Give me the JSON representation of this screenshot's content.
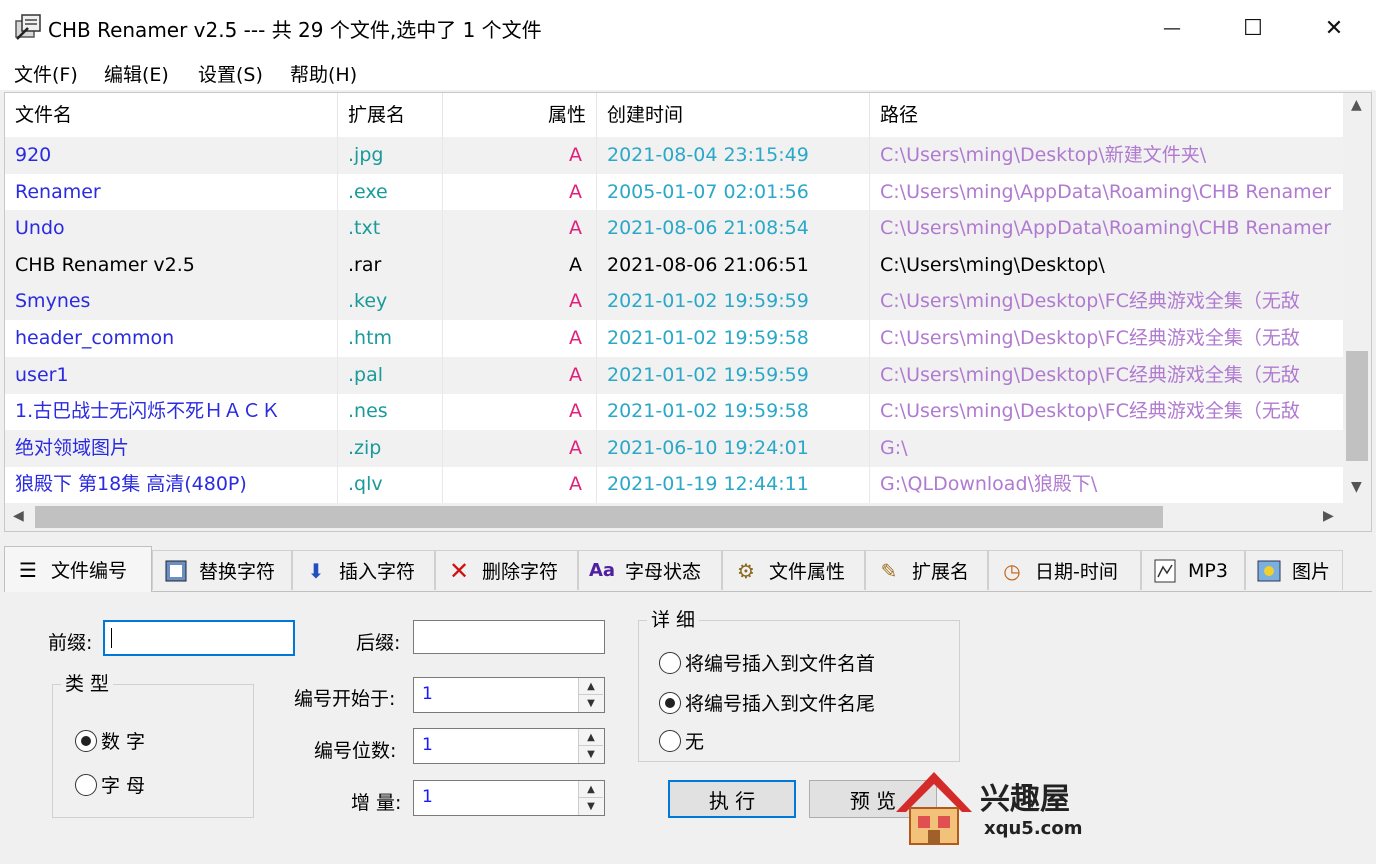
{
  "window": {
    "title": "CHB Renamer v2.5 --- 共 29 个文件,选中了 1 个文件",
    "minimize_glyph": "—",
    "maximize_glyph": "☐",
    "close_glyph": "✕"
  },
  "menu": [
    "文件(F)",
    "编辑(E)",
    "设置(S)",
    "帮助(H)"
  ],
  "list": {
    "headers": [
      "文件名",
      "扩展名",
      "属性",
      "创建时间",
      "路径"
    ],
    "rows": [
      {
        "name": "920",
        "ext": ".jpg",
        "attr": "A",
        "time": "2021-08-04 23:15:49",
        "path": "C:\\Users\\ming\\Desktop\\新建文件夹\\",
        "selected": false
      },
      {
        "name": "Renamer",
        "ext": ".exe",
        "attr": "A",
        "time": "2005-01-07 02:01:56",
        "path": "C:\\Users\\ming\\AppData\\Roaming\\CHB Renamer",
        "selected": false
      },
      {
        "name": "Undo",
        "ext": ".txt",
        "attr": "A",
        "time": "2021-08-06 21:08:54",
        "path": "C:\\Users\\ming\\AppData\\Roaming\\CHB Renamer",
        "selected": false
      },
      {
        "name": "CHB Renamer v2.5",
        "ext": ".rar",
        "attr": "A",
        "time": "2021-08-06 21:06:51",
        "path": "C:\\Users\\ming\\Desktop\\",
        "selected": true
      },
      {
        "name": "Smynes",
        "ext": ".key",
        "attr": "A",
        "time": "2021-01-02 19:59:59",
        "path": "C:\\Users\\ming\\Desktop\\FC经典游戏全集（无敌",
        "selected": false
      },
      {
        "name": "header_common",
        "ext": ".htm",
        "attr": "A",
        "time": "2021-01-02 19:59:58",
        "path": "C:\\Users\\ming\\Desktop\\FC经典游戏全集（无敌",
        "selected": false
      },
      {
        "name": "user1",
        "ext": ".pal",
        "attr": "A",
        "time": "2021-01-02 19:59:59",
        "path": "C:\\Users\\ming\\Desktop\\FC经典游戏全集（无敌",
        "selected": false
      },
      {
        "name": "1.古巴战士无闪烁不死ＨＡＣＫ",
        "ext": ".nes",
        "attr": "A",
        "time": "2021-01-02 19:59:58",
        "path": "C:\\Users\\ming\\Desktop\\FC经典游戏全集（无敌",
        "selected": false
      },
      {
        "name": "绝对领域图片",
        "ext": ".zip",
        "attr": "A",
        "time": "2021-06-10 19:24:01",
        "path": "G:\\",
        "selected": false
      },
      {
        "name": "狼殿下 第18集 高清(480P)",
        "ext": ".qlv",
        "attr": "A",
        "time": "2021-01-19 12:44:11",
        "path": "G:\\QLDownload\\狼殿下\\",
        "selected": false
      }
    ],
    "colors": {
      "name": "#2a2ae0",
      "ext": "#1a9a9a",
      "attr": "#e0207a",
      "time": "#2aa8c8",
      "path": "#b07ad0",
      "selected": "#000000"
    }
  },
  "tabs": [
    {
      "label": "文件编号",
      "icon": "list-icon",
      "active": true
    },
    {
      "label": "替换字符",
      "icon": "replace-icon",
      "active": false
    },
    {
      "label": "插入字符",
      "icon": "insert-icon",
      "active": false
    },
    {
      "label": "删除字符",
      "icon": "delete-icon",
      "active": false
    },
    {
      "label": "字母状态",
      "icon": "letter-case-icon",
      "active": false
    },
    {
      "label": "文件属性",
      "icon": "gear-icon",
      "active": false
    },
    {
      "label": "扩展名",
      "icon": "extension-icon",
      "active": false
    },
    {
      "label": "日期-时间",
      "icon": "clock-icon",
      "active": false
    },
    {
      "label": "MP3",
      "icon": "audio-icon",
      "active": false
    },
    {
      "label": "图片",
      "icon": "picture-icon",
      "active": false
    }
  ],
  "numbering": {
    "prefix_label": "前缀:",
    "prefix_value": "",
    "suffix_label": "后缀:",
    "suffix_value": "",
    "type_title": "类 型",
    "type_digit": "数 字",
    "type_letter": "字 母",
    "type_selected": "digit",
    "start_label": "编号开始于:",
    "start_value": "1",
    "digits_label": "编号位数:",
    "digits_value": "1",
    "step_label": "增 量:",
    "step_value": "1",
    "detail_title": "详 细",
    "opt_head": "将编号插入到文件名首",
    "opt_tail": "将编号插入到文件名尾",
    "opt_none": "无",
    "detail_selected": "tail",
    "execute_label": "执 行",
    "preview_label": "预 览"
  },
  "watermark": {
    "brand": "兴趣屋",
    "url": "xqu5.com"
  }
}
